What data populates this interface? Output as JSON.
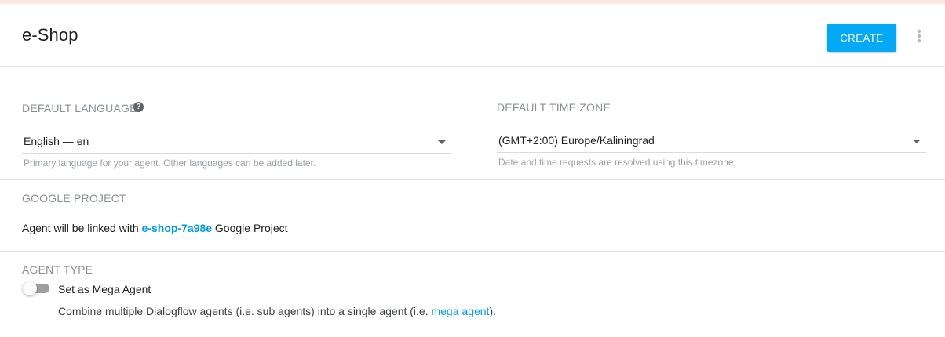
{
  "header": {
    "title": "e-Shop",
    "create_label": "CREATE",
    "menu_icon": "more-vert-icon"
  },
  "language": {
    "label": "DEFAULT LANGUAGE",
    "help_icon": "help-circle-icon",
    "help_glyph": "?",
    "value": "English — en",
    "hint": "Primary language for your agent. Other languages can be added later."
  },
  "timezone": {
    "label": "DEFAULT TIME ZONE",
    "value": "(GMT+2:00) Europe/Kaliningrad",
    "hint": "Date and time requests are resolved using this timezone."
  },
  "google_project": {
    "label": "GOOGLE PROJECT",
    "text_before": "Agent will be linked with ",
    "project_id": "e-shop-7a98e",
    "text_after": " Google Project"
  },
  "agent_type": {
    "label": "AGENT TYPE",
    "toggle_label": "Set as Mega Agent",
    "toggle_on": false,
    "description_before": "Combine multiple Dialogflow agents (i.e. sub agents) into a single agent (i.e. ",
    "description_link": "mega agent",
    "description_after": ")."
  },
  "colors": {
    "accent": "#03a9f4",
    "link": "#039be5",
    "top_strip": "#fde7e3"
  }
}
